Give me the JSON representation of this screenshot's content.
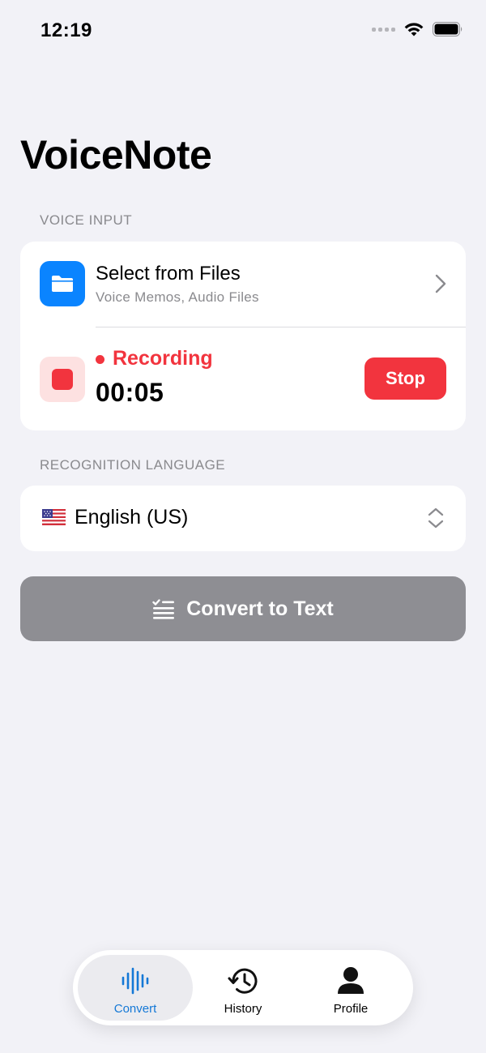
{
  "status_bar": {
    "time": "12:19"
  },
  "app": {
    "title": "VoiceNote"
  },
  "voice_input": {
    "section_label": "VOICE INPUT",
    "files": {
      "title": "Select from Files",
      "subtitle": "Voice Memos, Audio Files",
      "icon": "folder-icon"
    },
    "recording": {
      "status": "Recording",
      "elapsed": "00:05",
      "stop_label": "Stop",
      "icon": "stop-square-icon"
    }
  },
  "language": {
    "section_label": "RECOGNITION LANGUAGE",
    "selected": "English (US)",
    "flag_icon": "us-flag-icon"
  },
  "convert_button": {
    "label": "Convert to Text",
    "icon": "text-checklist-icon"
  },
  "tabs": [
    {
      "label": "Convert",
      "icon": "waveform-icon",
      "active": true
    },
    {
      "label": "History",
      "icon": "clock-history-icon",
      "active": false
    },
    {
      "label": "Profile",
      "icon": "person-icon",
      "active": false
    }
  ],
  "colors": {
    "background": "#F2F2F7",
    "accent_blue": "#0A84FF",
    "tab_active": "#1478D6",
    "record_red": "#F2343E",
    "record_bg": "#FDE1E1",
    "disabled_gray": "#8E8E93"
  }
}
